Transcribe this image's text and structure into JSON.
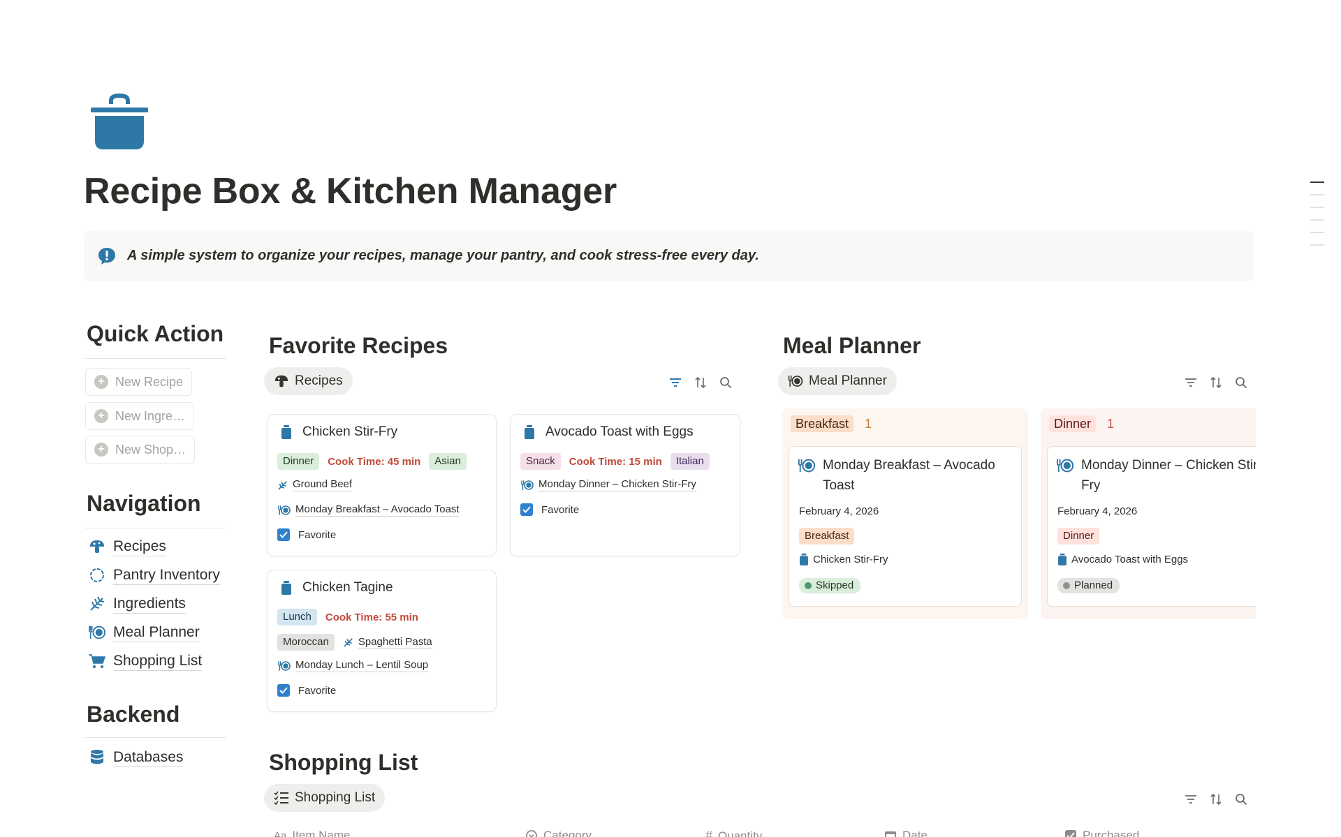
{
  "page": {
    "title": "Recipe Box & Kitchen Manager",
    "callout": "A simple system to organize your recipes, manage your pantry, and cook stress-free every day.",
    "icon": "cooking-pot-icon",
    "accent": "#2e78a8"
  },
  "quick_action": {
    "heading": "Quick Action",
    "buttons": [
      "New Recipe",
      "New Ingre…",
      "New Shop…"
    ]
  },
  "navigation": {
    "heading": "Navigation",
    "items": [
      "Recipes",
      "Pantry Inventory",
      "Ingredients",
      "Meal Planner",
      "Shopping List"
    ]
  },
  "backend": {
    "heading": "Backend",
    "items": [
      "Databases"
    ]
  },
  "favorite_recipes": {
    "heading": "Favorite Recipes",
    "view_label": "Recipes",
    "cards": [
      {
        "title": "Chicken Stir-Fry",
        "meal": "Dinner",
        "cook_time": "Cook Time: 45 min",
        "cuisine": "Asian",
        "ingredient": "Ground Beef",
        "meal_plan": "Monday Breakfast – Avocado Toast",
        "favorite": "Favorite"
      },
      {
        "title": "Avocado Toast with Eggs",
        "meal": "Snack",
        "cook_time": "Cook Time: 15 min",
        "cuisine": "Italian",
        "meal_plan": "Monday Dinner – Chicken Stir-Fry",
        "favorite": "Favorite"
      },
      {
        "title": "Chicken Tagine",
        "meal": "Lunch",
        "cook_time": "Cook Time: 55 min",
        "cuisine": "Moroccan",
        "ingredient": "Spaghetti Pasta",
        "meal_plan": "Monday Lunch – Lentil Soup",
        "favorite": "Favorite"
      }
    ]
  },
  "meal_planner": {
    "heading": "Meal Planner",
    "view_label": "Meal Planner",
    "columns": [
      {
        "name": "Breakfast",
        "count": "1",
        "card": {
          "title": "Monday Breakfast – Avocado Toast",
          "date": "February 4, 2026",
          "meal": "Breakfast",
          "recipe": "Chicken Stir-Fry",
          "status": "Skipped"
        }
      },
      {
        "name": "Dinner",
        "count": "1",
        "card": {
          "title": "Monday Dinner – Chicken Stir-Fry",
          "date": "February 4, 2026",
          "meal": "Dinner",
          "recipe": "Avocado Toast with Eggs",
          "status": "Planned"
        }
      }
    ]
  },
  "shopping_list": {
    "heading": "Shopping List",
    "view_label": "Shopping List",
    "columns": [
      "Item Name",
      "Category",
      "Quantity",
      "Date",
      "Purchased"
    ]
  },
  "colors": {
    "dinner_tag": "#dbeddb",
    "snack_tag": "#f5e0e9",
    "lunch_tag": "#d3e5ef",
    "cuisine_asian": "#dbeddb",
    "cuisine_italian": "#e8deee",
    "cuisine_moroccan": "#e3e2e0",
    "breakfast_col": "#fdf5f0",
    "dinner_col": "#fdf3f1"
  }
}
